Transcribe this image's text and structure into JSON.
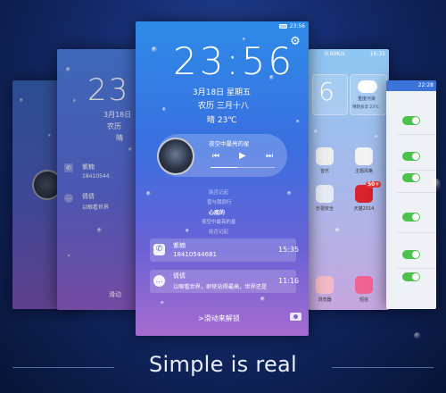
{
  "tagline": "Simple is real",
  "center": {
    "status_time": "23:56",
    "clock": "23:56",
    "date": "3月18日 星期五",
    "lunar": "农历 三月十八",
    "weather": "晴 23℃",
    "song_title": "夜空中最亮的星",
    "lyrics": [
      "能否记起",
      "曾与我同行",
      "心底的",
      "夜空中最亮的星",
      "能否记起"
    ],
    "notif1_name": "紫楠",
    "notif1_number": "18410544681",
    "notif1_time": "15:35",
    "notif2_name": "倩倩",
    "notif2_text": "以眼看世界，即使站得最高，世界还是",
    "notif2_time": "11:16",
    "unlock_hint": ">滑动来解锁"
  },
  "midleft": {
    "clock": "23",
    "date": "3月18日",
    "lunar": "农历",
    "weather": "晴",
    "notif1_name": "紫楠",
    "notif1_number": "18410544",
    "notif2_name": "倩倩",
    "notif2_text": "以眼看世界",
    "unlock_hint": "滑动"
  },
  "midright": {
    "status_speed": "0.60K/s",
    "status_time": "16:31",
    "clock": "6",
    "weather_label": "重度污染",
    "weather_detail": "晴转多云 23℃",
    "apps": [
      "音乐",
      "主题风格",
      "乐视安全",
      "天猫2014",
      "浏览器",
      "短信"
    ],
    "badge": "50+"
  },
  "right": {
    "status_time": "22:28"
  }
}
